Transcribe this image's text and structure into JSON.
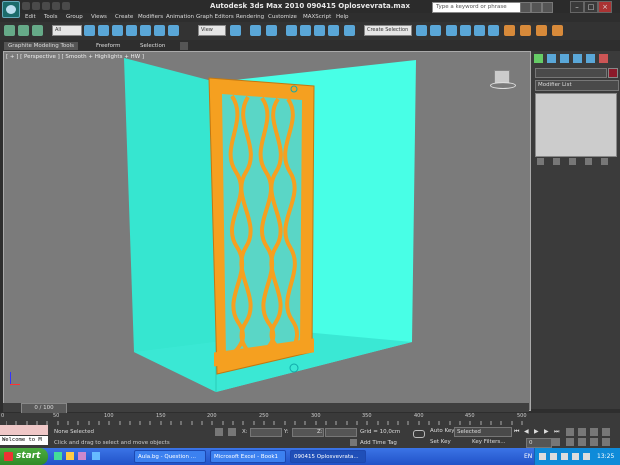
{
  "window": {
    "title": "Autodesk 3ds Max  2010     090415 Oplosvevrata.max",
    "search_placeholder": "Type a keyword or phrase"
  },
  "menu": [
    "Edit",
    "Tools",
    "Group",
    "Views",
    "Create",
    "Modifiers",
    "Animation",
    "Graph Editors",
    "Rendering",
    "Customize",
    "MAXScript",
    "Help"
  ],
  "toolbar": {
    "selection_filter": "All",
    "reference_coord": "View",
    "named_selection": "Create Selection S"
  },
  "ribbon": {
    "tabs": [
      "Graphite Modeling Tools",
      "Freeform",
      "Selection"
    ]
  },
  "viewport": {
    "label": "[ + ] [ Perspective ] [ Smooth + Highlights + HW ]",
    "colors": {
      "background": "#7b7b7b",
      "walls": "#40ffe0",
      "floor": "#44f2d8",
      "frame": "#f5a020"
    }
  },
  "command_panel": {
    "modifier_list": "Modifier List"
  },
  "timeline": {
    "slider_label": "0 / 100",
    "ticks": [
      "0",
      "10",
      "20",
      "30",
      "40",
      "50",
      "60",
      "70",
      "80",
      "90",
      "100",
      "110",
      "120",
      "130",
      "140",
      "150",
      "160",
      "170",
      "180",
      "190",
      "200",
      "210",
      "220",
      "230",
      "240",
      "250",
      "260",
      "270",
      "280",
      "290",
      "300",
      "310",
      "320",
      "330",
      "340",
      "350",
      "360",
      "370",
      "380",
      "390",
      "400",
      "410",
      "420",
      "430",
      "440",
      "450",
      "460",
      "470",
      "480",
      "490",
      "500"
    ]
  },
  "status": {
    "script_listener": "Welcome to M",
    "selection": "None Selected",
    "prompt": "Click and drag to select and move objects",
    "x_label": "X:",
    "y_label": "Y:",
    "z_label": "Z:",
    "grid": "Grid = 10,0cm",
    "add_time_tag": "Add Time Tag",
    "auto_key": "Auto Key",
    "set_key": "Set Key",
    "selected": "Selected",
    "key_filters": "Key Filters...",
    "frame": "0"
  },
  "taskbar": {
    "start": "start",
    "items": [
      "Aula.bg - Question ...",
      "Microsoft Excel - Book1",
      "090415 Oplosvevrata..."
    ],
    "lang": "EN",
    "time": "13:25"
  }
}
